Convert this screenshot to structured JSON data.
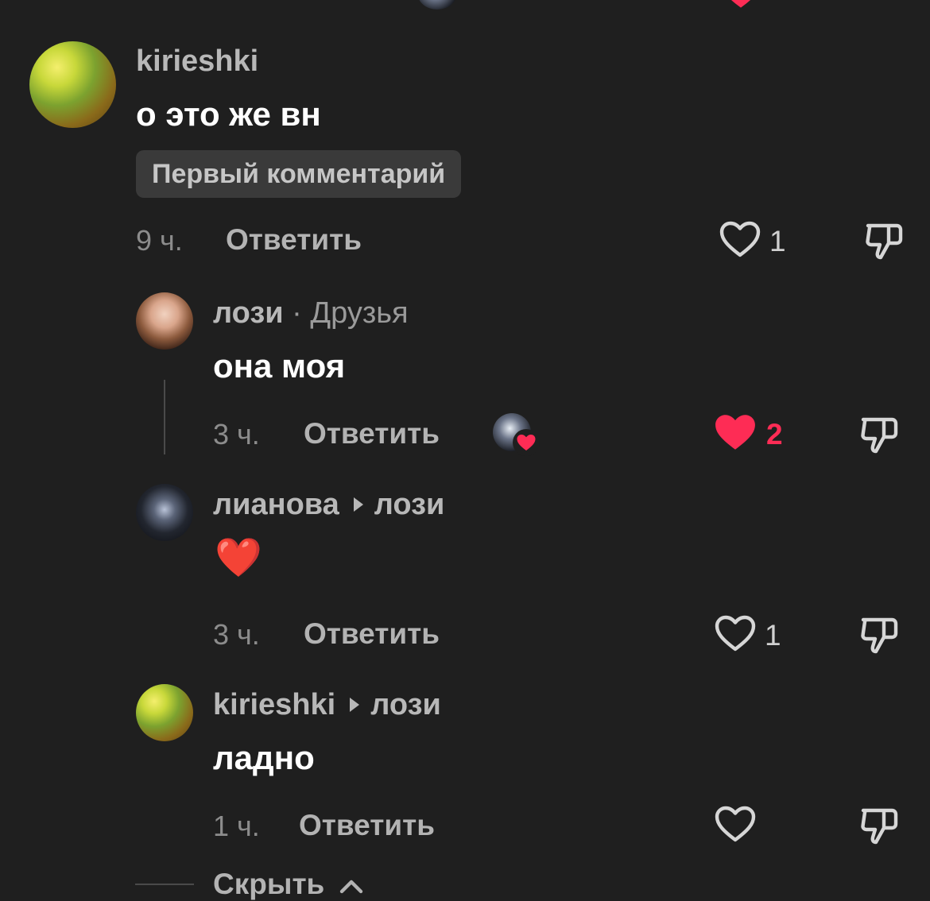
{
  "comments": [
    {
      "username": "kirieshki",
      "text": "о это же вн",
      "badge": "Первый комментарий",
      "time": "9 ч.",
      "reply_label": "Ответить",
      "likes": "1",
      "liked": false
    },
    {
      "username": "лози",
      "username_suffix": "· Друзья",
      "text": "она моя",
      "time": "3 ч.",
      "reply_label": "Ответить",
      "likes": "2",
      "liked": true,
      "creator_liked": true
    },
    {
      "username": "лианова",
      "reply_to": "лози",
      "text": "❤️",
      "time": "3 ч.",
      "reply_label": "Ответить",
      "likes": "1",
      "liked": false
    },
    {
      "username": "kirieshki",
      "reply_to": "лози",
      "text": "ладно",
      "time": "1 ч.",
      "reply_label": "Ответить",
      "likes": "",
      "liked": false
    }
  ],
  "footer": {
    "hide_label": "Скрыть"
  },
  "colors": {
    "background": "#1f1f1f",
    "like_active": "#fe2c55",
    "muted_text": "#8c8c8c"
  },
  "icons": [
    "heart-outline-icon",
    "heart-filled-icon",
    "dislike-icon",
    "chevron-up-icon",
    "reply-to-arrow-icon"
  ]
}
